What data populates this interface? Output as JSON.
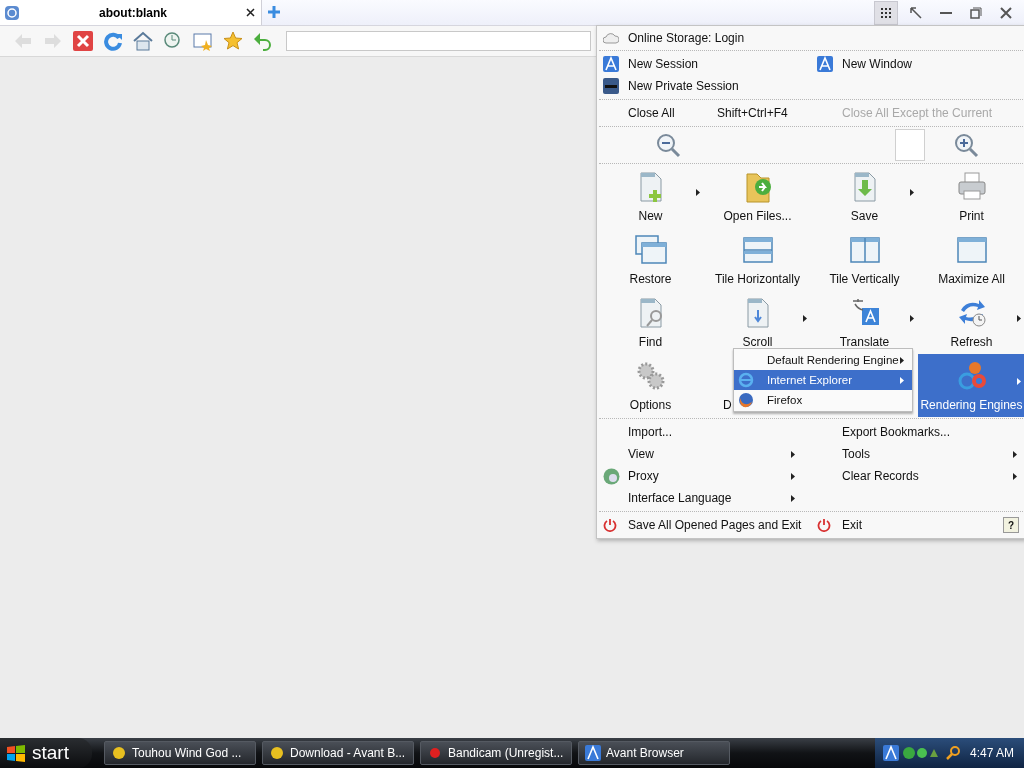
{
  "tabs": [
    {
      "title": "about:blank",
      "selected": true
    }
  ],
  "menu": {
    "online_storage": "Online Storage: Login",
    "sessions": [
      {
        "label": "New Session"
      },
      {
        "label": "New Window"
      },
      {
        "label": "New Private Session"
      }
    ],
    "close_row": {
      "label": "Close All",
      "shortcut": "Shift+Ctrl+F4",
      "other": "Close All Except the Current",
      "other_disabled": true
    },
    "tiles": [
      {
        "label": "New",
        "submenu": true,
        "selected": false
      },
      {
        "label": "Open Files...",
        "submenu": false,
        "selected": false
      },
      {
        "label": "Save",
        "submenu": true,
        "selected": false
      },
      {
        "label": "Print",
        "submenu": false,
        "selected": false
      },
      {
        "label": "Restore",
        "submenu": false,
        "selected": false
      },
      {
        "label": "Tile Horizontally",
        "submenu": false,
        "selected": false
      },
      {
        "label": "Tile Vertically",
        "submenu": false,
        "selected": false
      },
      {
        "label": "Maximize All",
        "submenu": false,
        "selected": false
      },
      {
        "label": "Find",
        "submenu": false,
        "selected": false
      },
      {
        "label": "Scroll",
        "submenu": true,
        "selected": false
      },
      {
        "label": "Translate",
        "submenu": true,
        "selected": false
      },
      {
        "label": "Refresh",
        "submenu": true,
        "selected": false
      },
      {
        "label": "Options",
        "submenu": false,
        "selected": false
      },
      {
        "label": "D",
        "submenu": false,
        "selected": false
      },
      {
        "label": "Rendering Engines",
        "submenu": true,
        "selected": true
      }
    ],
    "items": [
      {
        "label": "Import...",
        "submenu": false
      },
      {
        "label": "Export Bookmarks...",
        "submenu": false
      },
      {
        "label": "View",
        "submenu": true
      },
      {
        "label": "Tools",
        "submenu": true
      },
      {
        "label": "Proxy",
        "submenu": true
      },
      {
        "label": "Clear Records",
        "submenu": true
      },
      {
        "label": "Interface Language",
        "submenu": true
      }
    ],
    "exit_items": [
      {
        "label": "Save All Opened Pages and Exit"
      },
      {
        "label": "Exit"
      }
    ],
    "help": "?"
  },
  "submenu": [
    {
      "label": "Default Rendering Engine",
      "submenu": true,
      "selected": false
    },
    {
      "label": "Internet Explorer",
      "submenu": true,
      "selected": true
    },
    {
      "label": "Firefox",
      "submenu": false,
      "selected": false
    }
  ],
  "taskbar": {
    "start": "start",
    "buttons": [
      {
        "label": "Touhou Wind God ..."
      },
      {
        "label": "Download - Avant B..."
      },
      {
        "label": "Bandicam (Unregist..."
      },
      {
        "label": "Avant Browser"
      }
    ],
    "clock": "4:47 AM"
  }
}
